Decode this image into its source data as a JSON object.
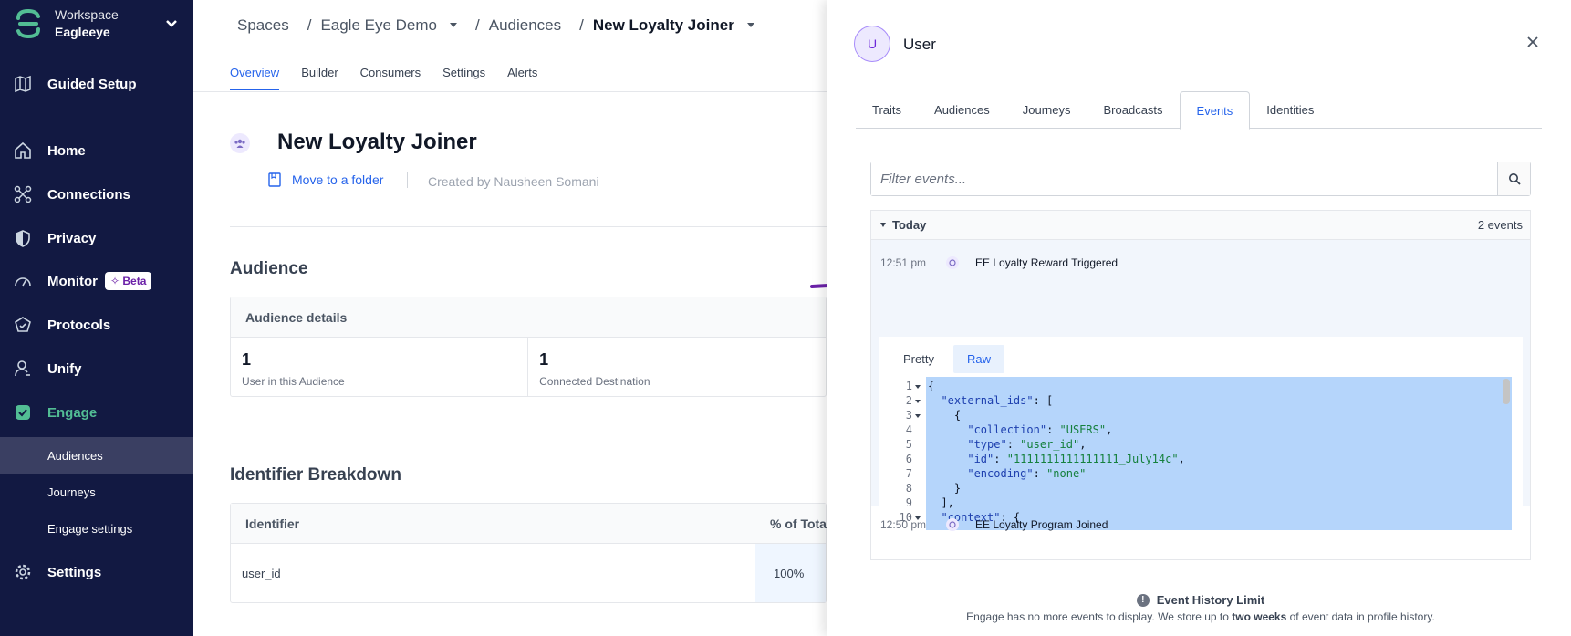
{
  "sidebar": {
    "workspace_label": "Workspace",
    "workspace_name": "Eagleeye",
    "items": [
      {
        "label": "Guided Setup"
      },
      {
        "label": "Home"
      },
      {
        "label": "Connections"
      },
      {
        "label": "Privacy"
      },
      {
        "label": "Monitor"
      },
      {
        "label": "Protocols"
      },
      {
        "label": "Unify"
      },
      {
        "label": "Engage"
      },
      {
        "label": "Settings"
      }
    ],
    "beta_badge": "Beta",
    "engage_sub": [
      {
        "label": "Audiences"
      },
      {
        "label": "Journeys"
      },
      {
        "label": "Engage settings"
      }
    ]
  },
  "breadcrumb": {
    "spaces": "Spaces",
    "space": "Eagle Eye Demo",
    "audiences": "Audiences",
    "current": "New Loyalty Joiner",
    "separator": "/"
  },
  "subtabs": [
    "Overview",
    "Builder",
    "Consumers",
    "Settings",
    "Alerts"
  ],
  "page": {
    "title": "New Loyalty Joiner",
    "move_folder": "Move to a folder",
    "created_by": "Created by Nausheen Somani",
    "audience_heading": "Audience",
    "audience_details": "Audience details",
    "stats": [
      {
        "value": "1",
        "label": "User in this Audience"
      },
      {
        "value": "1",
        "label": "Connected Destination"
      }
    ],
    "identifier_heading": "Identifier Breakdown",
    "identifier_col": "Identifier",
    "pct_col": "% of Total",
    "rows": [
      {
        "identifier": "user_id",
        "pct": "100%"
      }
    ]
  },
  "drawer": {
    "avatar_letter": "U",
    "user_label": "User",
    "tabs": [
      "Traits",
      "Audiences",
      "Journeys",
      "Broadcasts",
      "Events",
      "Identities"
    ],
    "active_tab": "Events",
    "filter_placeholder": "Filter events...",
    "group_label": "Today",
    "group_count": "2 events",
    "events": [
      {
        "time": "12:51 pm",
        "name": "EE Loyalty Reward Triggered"
      },
      {
        "time": "12:50 pm",
        "name": "EE Loyalty Program Joined"
      }
    ],
    "view_pretty": "Pretty",
    "view_raw": "Raw",
    "code_lines": [
      "1",
      "2",
      "3",
      "4",
      "5",
      "6",
      "7",
      "8",
      "9",
      "10"
    ],
    "json": {
      "external_ids_key": "\"external_ids\"",
      "collection_key": "\"collection\"",
      "collection_val": "\"USERS\"",
      "type_key": "\"type\"",
      "type_val": "\"user_id\"",
      "id_key": "\"id\"",
      "id_val": "\"1111111111111111_July14c\"",
      "encoding_key": "\"encoding\"",
      "encoding_val": "\"none\"",
      "context_key": "\"context\""
    },
    "history_title": "Event History Limit",
    "history_desc_pre": "Engage has no more events to display. We store up to ",
    "history_desc_bold": "two weeks",
    "history_desc_post": " of event data in profile history."
  },
  "colors": {
    "sidebar_bg": "#121942",
    "engage_accent": "#52bd94",
    "link_blue": "#2563eb",
    "annotation_arrow": "#6b21a8",
    "code_selection": "#b5d5fb"
  }
}
